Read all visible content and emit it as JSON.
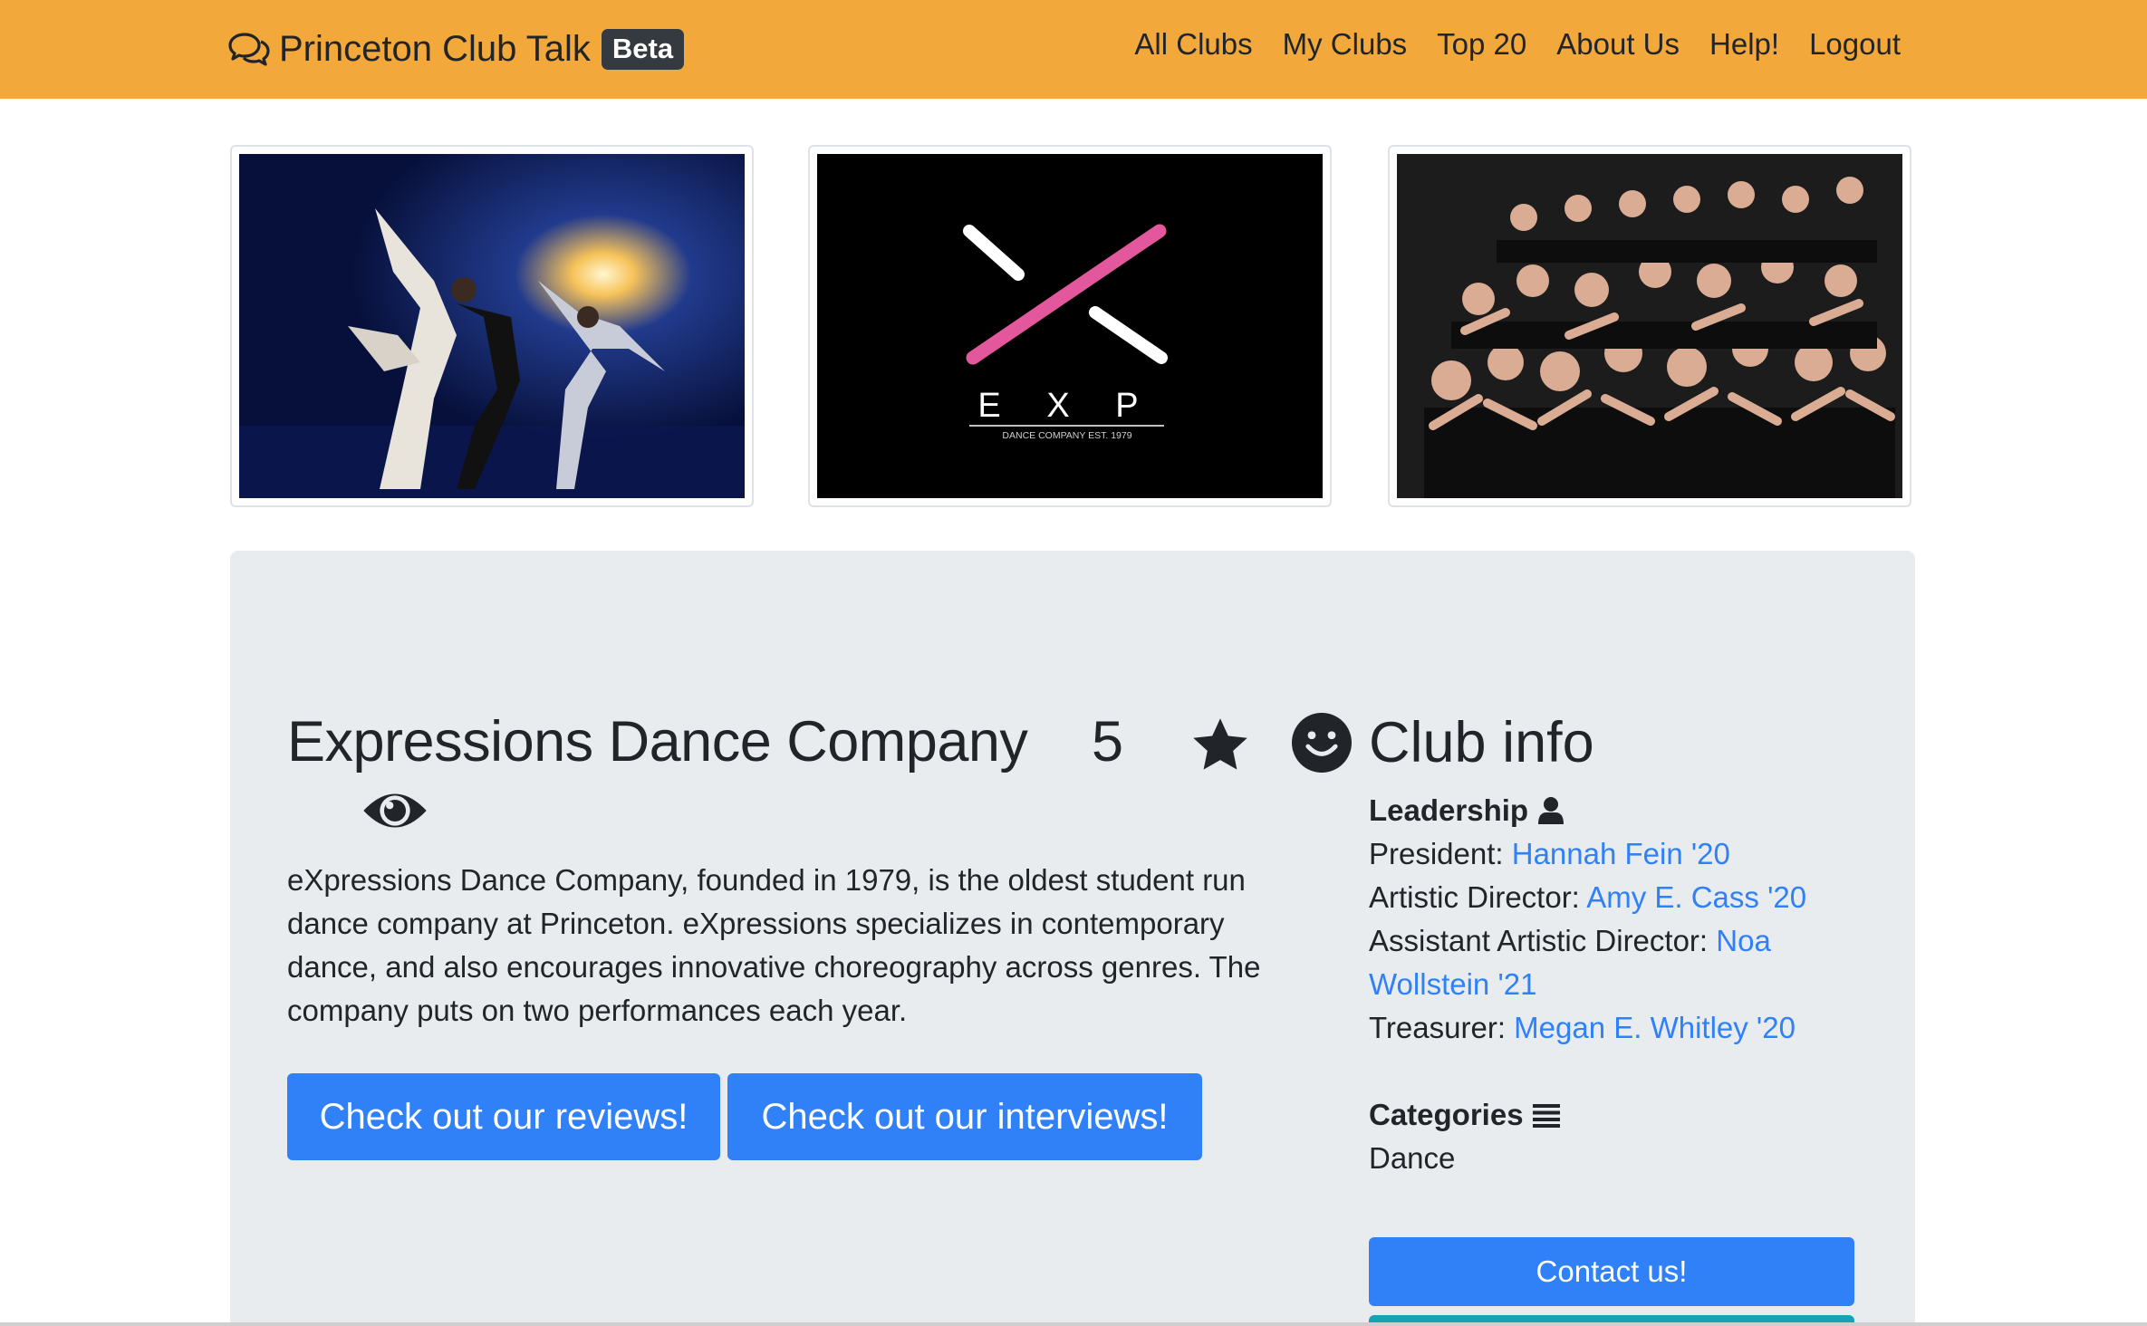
{
  "navbar": {
    "brand": "Princeton Club Talk",
    "badge": "Beta",
    "links": [
      "All Clubs",
      "My Clubs",
      "Top 20",
      "About Us",
      "Help!",
      "Logout"
    ],
    "bg_color": "#f3a83b"
  },
  "gallery": {
    "images": [
      {
        "icon": "dancers-photo"
      },
      {
        "icon": "exp-logo",
        "logo_text": "E X P",
        "logo_subtext": "DANCE COMPANY EST. 1979"
      },
      {
        "icon": "group-photo"
      }
    ]
  },
  "club": {
    "name": "Expressions Dance Company",
    "rating": "5",
    "description": "eXpressions Dance Company, founded in 1979, is the oldest student run dance company at Princeton. eXpressions specializes in contemporary dance, and also encourages innovative choreography across genres. The company puts on two performances each year.",
    "reviews_button": "Check out our reviews!",
    "interviews_button": "Check out our interviews!"
  },
  "info": {
    "title": "Club info",
    "leadership_label": "Leadership",
    "leaders": [
      {
        "role": "President: ",
        "name": "Hannah Fein '20"
      },
      {
        "role": "Artistic Director: ",
        "name": "Amy E. Cass '20"
      },
      {
        "role": "Assistant Artistic Director: ",
        "name": "Noa Wollstein '21"
      },
      {
        "role": "Treasurer: ",
        "name": "Megan E. Whitley '20"
      }
    ],
    "categories_label": "Categories",
    "category": "Dance",
    "contact_button": "Contact us!"
  },
  "colors": {
    "primary": "#3081f8",
    "link": "#3081f8",
    "teal": "#17a2b8",
    "jumbotron": "#e9ecef"
  }
}
